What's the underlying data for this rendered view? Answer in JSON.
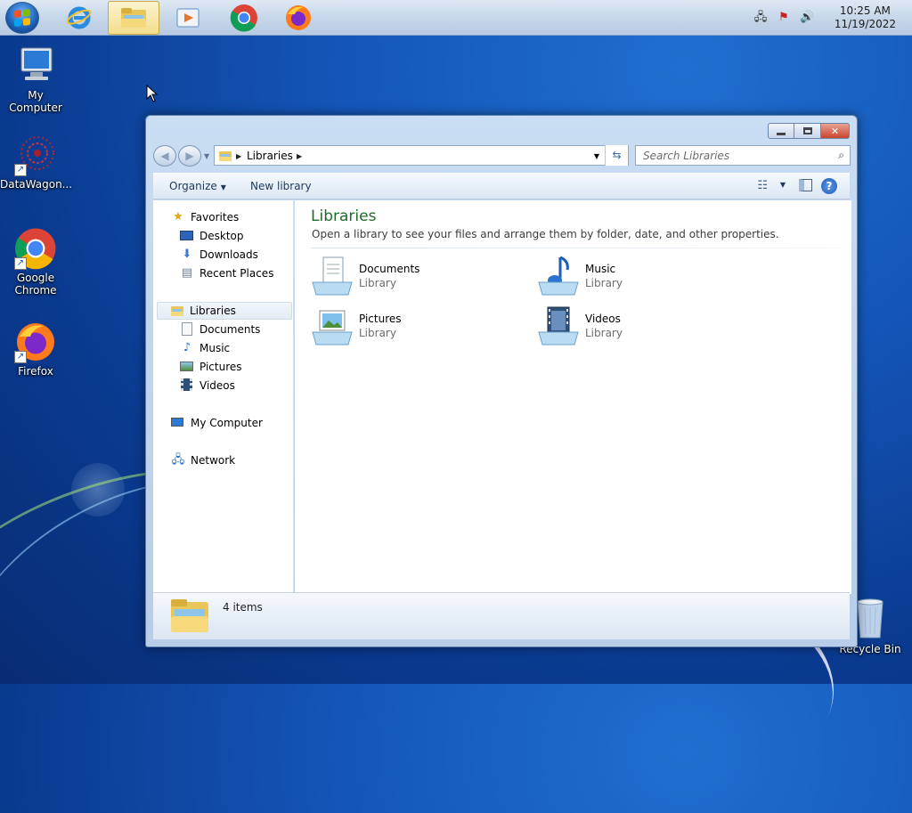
{
  "taskbar": {
    "clock_time": "10:25 AM",
    "clock_date": "11/19/2022",
    "apps": [
      "internet-explorer",
      "file-explorer",
      "media-player",
      "chrome",
      "firefox"
    ]
  },
  "desktop": {
    "icons": [
      {
        "label": "My Computer"
      },
      {
        "label": "DataWagon..."
      },
      {
        "label": "Google Chrome"
      },
      {
        "label": "Firefox"
      },
      {
        "label": "Recycle Bin"
      }
    ]
  },
  "window": {
    "address": "Libraries",
    "search_placeholder": "Search Libraries",
    "toolbar": {
      "organize": "Organize",
      "new_library": "New library"
    },
    "nav": {
      "favorites": "Favorites",
      "favorites_items": [
        "Desktop",
        "Downloads",
        "Recent Places"
      ],
      "libraries": "Libraries",
      "libraries_items": [
        "Documents",
        "Music",
        "Pictures",
        "Videos"
      ],
      "computer": "My Computer",
      "network": "Network"
    },
    "content": {
      "title": "Libraries",
      "subtitle": "Open a library to see your files and arrange them by folder, date, and other properties.",
      "libraries": [
        {
          "name": "Documents",
          "type": "Library"
        },
        {
          "name": "Music",
          "type": "Library"
        },
        {
          "name": "Pictures",
          "type": "Library"
        },
        {
          "name": "Videos",
          "type": "Library"
        }
      ]
    },
    "status": "4 items"
  },
  "colors": {
    "accent_title": "#1e6b2c",
    "taskbar_active": "#f3dd8c"
  }
}
